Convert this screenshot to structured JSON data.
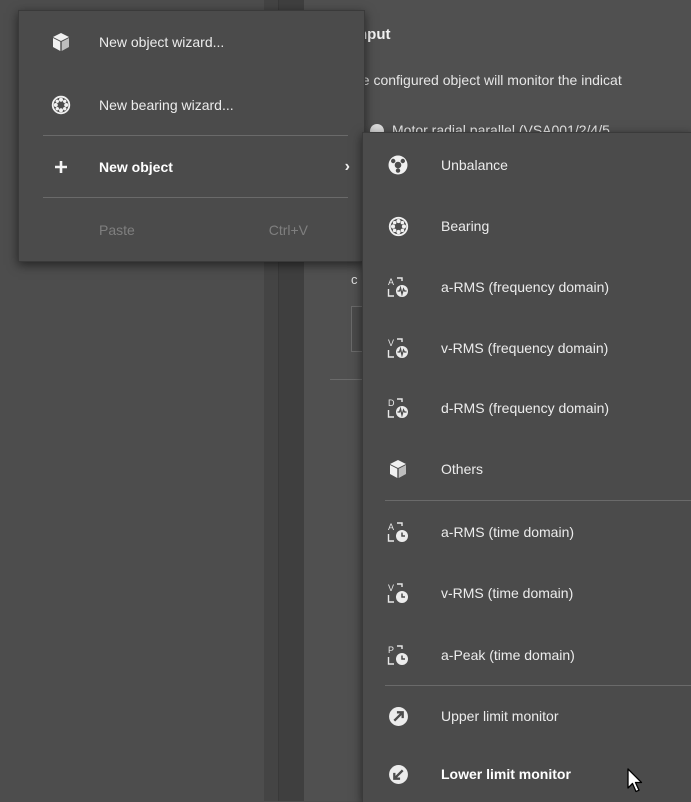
{
  "background": {
    "heading": "nput",
    "description": "ne configured object will monitor the indicat",
    "list_item": "Motor radial parallel (VSA001/2/4/5",
    "truncated_label": "c"
  },
  "context_menu": {
    "items": [
      {
        "label": "New object wizard...",
        "icon": "cube-icon"
      },
      {
        "label": "New bearing wizard...",
        "icon": "bearing-icon"
      },
      {
        "label": "New object",
        "icon": "plus-icon",
        "has_submenu": true
      },
      {
        "label": "Paste",
        "shortcut": "Ctrl+V",
        "disabled": true
      }
    ]
  },
  "submenu": {
    "items": [
      {
        "label": "Unbalance",
        "icon": "unbalance-icon"
      },
      {
        "label": "Bearing",
        "icon": "bearing-icon"
      },
      {
        "label": "a-RMS (frequency domain)",
        "icon": "a-freq-icon"
      },
      {
        "label": "v-RMS (frequency domain)",
        "icon": "v-freq-icon"
      },
      {
        "label": "d-RMS (frequency domain)",
        "icon": "d-freq-icon"
      },
      {
        "label": "Others",
        "icon": "cube-icon"
      },
      {
        "label": "a-RMS (time domain)",
        "icon": "a-time-icon"
      },
      {
        "label": "v-RMS (time domain)",
        "icon": "v-time-icon"
      },
      {
        "label": "a-Peak (time domain)",
        "icon": "p-time-icon"
      },
      {
        "label": "Upper limit monitor",
        "icon": "upper-limit-icon"
      },
      {
        "label": "Lower limit monitor",
        "icon": "lower-limit-icon",
        "highlighted": true
      }
    ]
  },
  "colors": {
    "menu_bg": "#4b4b4b",
    "text": "#ececec",
    "disabled": "#7f7f7f",
    "separator": "#6a6a6a"
  }
}
